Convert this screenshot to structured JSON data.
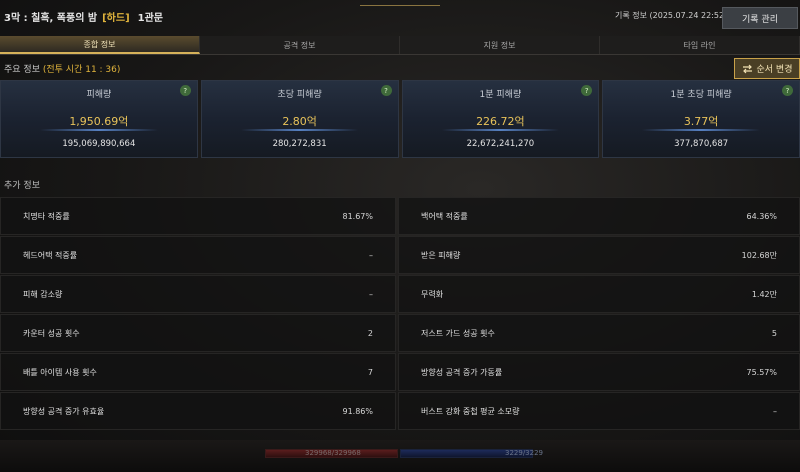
{
  "header": {
    "raid_title": "3막 : 칠흑, 폭풍의 밤",
    "difficulty": "[하드]",
    "gate": "1관문",
    "record_info": "기록 정보 (2025.07.24 22:52:28)",
    "manage_button": "기록 관리"
  },
  "tabs": [
    {
      "label": "종합 정보",
      "active": true
    },
    {
      "label": "공격 정보",
      "active": false
    },
    {
      "label": "지원 정보",
      "active": false
    },
    {
      "label": "타임 라인",
      "active": false
    }
  ],
  "main": {
    "section_label": "주요 정보",
    "battle_time": "(전투 시간 11 : 36)",
    "sort_button": "순서 변경",
    "sort_icon": "swap-arrows-icon",
    "cards": [
      {
        "title": "피해량",
        "value": "1,950.69억",
        "raw": "195,069,890,664"
      },
      {
        "title": "초당 피해량",
        "value": "2.80억",
        "raw": "280,272,831"
      },
      {
        "title": "1분 피해량",
        "value": "226.72억",
        "raw": "22,672,241,270"
      },
      {
        "title": "1분 초당 피해량",
        "value": "3.77억",
        "raw": "377,870,687"
      }
    ],
    "help_glyph": "?",
    "extra_label": "추가 정보",
    "stats": [
      {
        "label": "치명타 적중률",
        "value": "81.67%"
      },
      {
        "label": "백어택 적중률",
        "value": "64.36%"
      },
      {
        "label": "헤드어택 적중률",
        "value": "–"
      },
      {
        "label": "받은 피해량",
        "value": "102.68만"
      },
      {
        "label": "피해 감소량",
        "value": "–"
      },
      {
        "label": "무력화",
        "value": "1.42만"
      },
      {
        "label": "카운터 성공 횟수",
        "value": "2"
      },
      {
        "label": "저스트 가드 성공 횟수",
        "value": "5"
      },
      {
        "label": "배틀 아이템 사용 횟수",
        "value": "7"
      },
      {
        "label": "방향성 공격 증가 가동률",
        "value": "75.57%"
      },
      {
        "label": "방향성 공격 증가 유효율",
        "value": "91.86%"
      },
      {
        "label": "버스트 강화 중첩 평균 소모량",
        "value": "–"
      }
    ]
  },
  "bottom": {
    "hp_text": "329968/329968",
    "mp_text": "3229/3229"
  },
  "colors": {
    "accent_gold": "#e0b43c",
    "background": "#181716",
    "card_blue": "#1b2230"
  }
}
